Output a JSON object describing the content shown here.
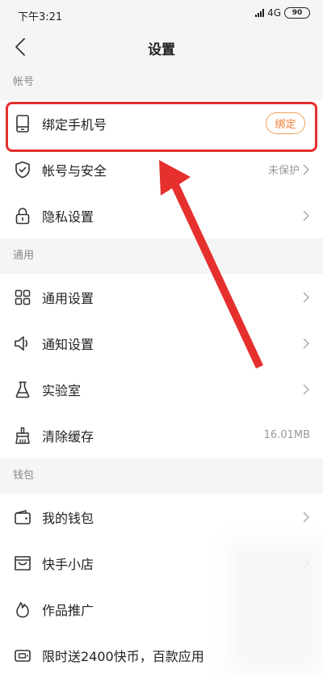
{
  "status_bar": {
    "time": "下午3:21",
    "network": "4G",
    "battery": "90"
  },
  "header": {
    "title": "设置"
  },
  "sections": [
    {
      "title": "帐号",
      "items": [
        {
          "label": "绑定手机号",
          "icon": "phone-icon",
          "action_label": "绑定"
        },
        {
          "label": "帐号与安全",
          "icon": "shield-icon",
          "value": "未保护"
        },
        {
          "label": "隐私设置",
          "icon": "lock-icon"
        }
      ]
    },
    {
      "title": "通用",
      "items": [
        {
          "label": "通用设置",
          "icon": "grid-icon"
        },
        {
          "label": "通知设置",
          "icon": "speaker-icon"
        },
        {
          "label": "实验室",
          "icon": "flask-icon"
        },
        {
          "label": "清除缓存",
          "icon": "broom-icon",
          "value": "16.01MB"
        }
      ]
    },
    {
      "title": "钱包",
      "items": [
        {
          "label": "我的钱包",
          "icon": "wallet-icon"
        },
        {
          "label": "快手小店",
          "icon": "shop-icon"
        },
        {
          "label": "作品推广",
          "icon": "flame-icon"
        },
        {
          "label": "限时送2400快币，百款应用",
          "icon": "coupon-icon"
        }
      ]
    }
  ],
  "colors": {
    "accent": "#f07c2b",
    "annotation": "#e5302e"
  }
}
